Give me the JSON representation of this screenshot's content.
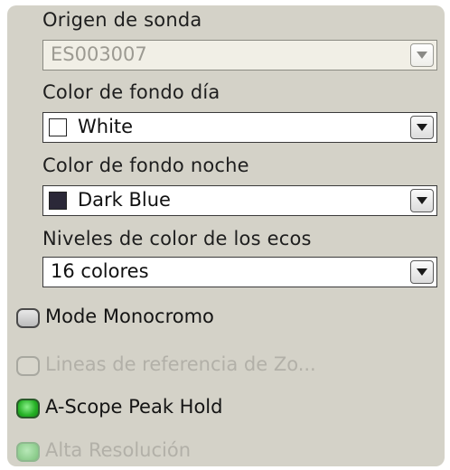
{
  "fields": {
    "origin": {
      "label": "Origen de sonda",
      "value": "ES003007",
      "enabled": false
    },
    "day_bg": {
      "label": "Color de fondo día",
      "value": "White",
      "swatch_color": "#ffffff"
    },
    "night_bg": {
      "label": "Color de fondo noche",
      "value": "Dark Blue",
      "swatch_color": "#2b2838"
    },
    "echo_levels": {
      "label": "Niveles de color de los ecos",
      "value": "16 colores"
    }
  },
  "checkboxes": [
    {
      "label": "Mode Monocromo",
      "checked": false,
      "enabled": true
    },
    {
      "label": "Lineas de referencia de Zo...",
      "checked": false,
      "enabled": false
    },
    {
      "label": "A-Scope Peak Hold",
      "checked": true,
      "enabled": true
    },
    {
      "label": "Alta Resolución",
      "checked": true,
      "enabled": false
    }
  ],
  "colors": {
    "panel_bg": "#d4d2c8",
    "checked_green": "#25b025"
  }
}
